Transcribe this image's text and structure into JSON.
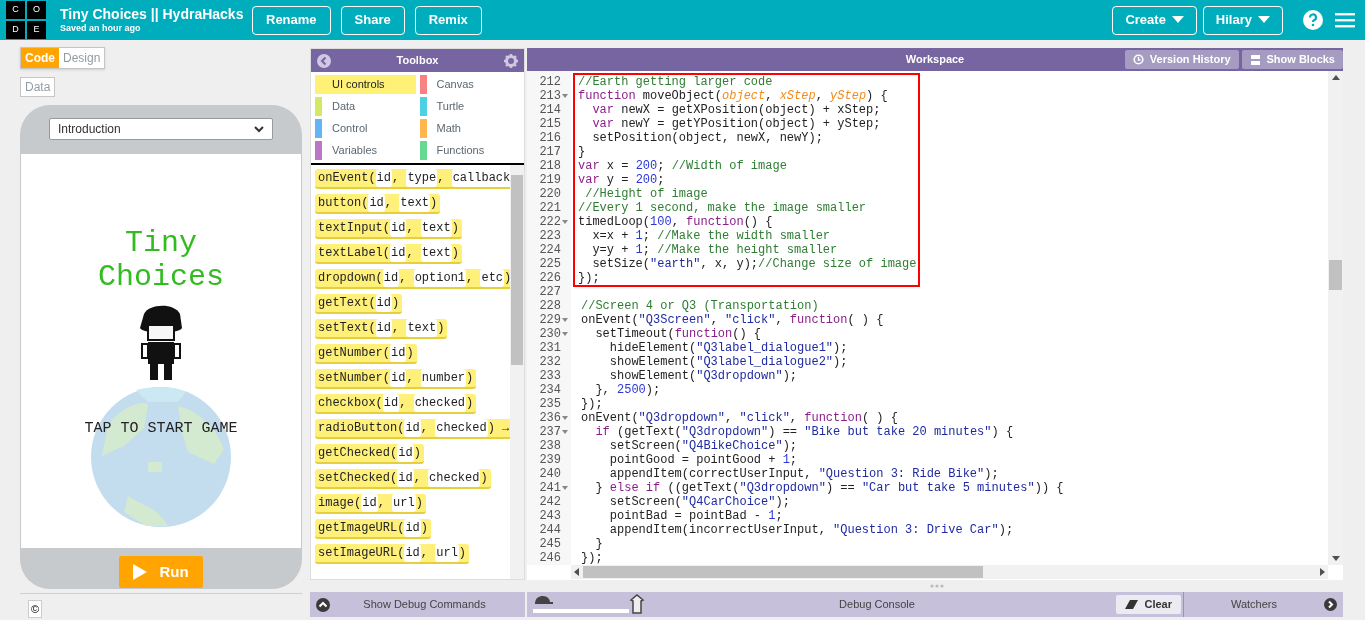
{
  "header": {
    "logo_letters": [
      "C",
      "O",
      "D",
      "E"
    ],
    "title": "Tiny Choices || HydraHacks",
    "subtitle": "Saved an hour ago",
    "buttons": [
      "Rename",
      "Share",
      "Remix"
    ],
    "menus": [
      "Create",
      "Hilary"
    ]
  },
  "mode_tabs": [
    {
      "label": "Code",
      "selected": true
    },
    {
      "label": "Design",
      "selected": false
    }
  ],
  "data_button": "Data",
  "app": {
    "screen_select": "Introduction",
    "title": "Tiny Choices",
    "tap_text": "TAP TO START GAME",
    "run_button": "Run"
  },
  "copyright": "©",
  "toolbox": {
    "title": "Toolbox",
    "categories": [
      {
        "label": "UI controls",
        "color": "#fff176",
        "selected": true
      },
      {
        "label": "Canvas",
        "color": "#f78183",
        "selected": false
      },
      {
        "label": "Data",
        "color": "#d3e965",
        "selected": false
      },
      {
        "label": "Turtle",
        "color": "#4dd0e1",
        "selected": false
      },
      {
        "label": "Control",
        "color": "#64b5f6",
        "selected": false
      },
      {
        "label": "Math",
        "color": "#ffb74d",
        "selected": false
      },
      {
        "label": "Variables",
        "color": "#bb77c7",
        "selected": false
      },
      {
        "label": "Functions",
        "color": "#68d995",
        "selected": false
      }
    ],
    "blocks": [
      [
        {
          "kind": "code",
          "text": "onEvent("
        },
        {
          "kind": "param",
          "text": "id"
        },
        {
          "kind": "code",
          "text": ", "
        },
        {
          "kind": "param",
          "text": "type"
        },
        {
          "kind": "code",
          "text": ", "
        },
        {
          "kind": "param",
          "text": "callback"
        }
      ],
      [
        {
          "kind": "code",
          "text": "button("
        },
        {
          "kind": "param",
          "text": "id"
        },
        {
          "kind": "code",
          "text": ", "
        },
        {
          "kind": "param",
          "text": "text"
        },
        {
          "kind": "code",
          "text": ")"
        }
      ],
      [
        {
          "kind": "code",
          "text": "textInput("
        },
        {
          "kind": "param",
          "text": "id"
        },
        {
          "kind": "code",
          "text": ", "
        },
        {
          "kind": "param",
          "text": "text"
        },
        {
          "kind": "code",
          "text": ")"
        }
      ],
      [
        {
          "kind": "code",
          "text": "textLabel("
        },
        {
          "kind": "param",
          "text": "id"
        },
        {
          "kind": "code",
          "text": ", "
        },
        {
          "kind": "param",
          "text": "text"
        },
        {
          "kind": "code",
          "text": ")"
        }
      ],
      [
        {
          "kind": "code",
          "text": "dropdown("
        },
        {
          "kind": "param",
          "text": "id"
        },
        {
          "kind": "code",
          "text": ", "
        },
        {
          "kind": "param",
          "text": "option1"
        },
        {
          "kind": "code",
          "text": ", "
        },
        {
          "kind": "param",
          "text": "etc"
        },
        {
          "kind": "code",
          "text": ")"
        }
      ],
      [
        {
          "kind": "code",
          "text": "getText("
        },
        {
          "kind": "param",
          "text": "id"
        },
        {
          "kind": "code",
          "text": ")"
        }
      ],
      [
        {
          "kind": "code",
          "text": "setText("
        },
        {
          "kind": "param",
          "text": "id"
        },
        {
          "kind": "code",
          "text": ", "
        },
        {
          "kind": "param",
          "text": "text"
        },
        {
          "kind": "code",
          "text": ")"
        }
      ],
      [
        {
          "kind": "code",
          "text": "getNumber("
        },
        {
          "kind": "param",
          "text": "id"
        },
        {
          "kind": "code",
          "text": ")"
        }
      ],
      [
        {
          "kind": "code",
          "text": "setNumber("
        },
        {
          "kind": "param",
          "text": "id"
        },
        {
          "kind": "code",
          "text": ", "
        },
        {
          "kind": "param",
          "text": "number"
        },
        {
          "kind": "code",
          "text": ")"
        }
      ],
      [
        {
          "kind": "code",
          "text": "checkbox("
        },
        {
          "kind": "param",
          "text": "id"
        },
        {
          "kind": "code",
          "text": ", "
        },
        {
          "kind": "param",
          "text": "checked"
        },
        {
          "kind": "code",
          "text": ")"
        }
      ],
      [
        {
          "kind": "code",
          "text": "radioButton("
        },
        {
          "kind": "param",
          "text": "id"
        },
        {
          "kind": "code",
          "text": ", "
        },
        {
          "kind": "param",
          "text": "checked"
        },
        {
          "kind": "code",
          "text": ") →"
        }
      ],
      [
        {
          "kind": "code",
          "text": "getChecked("
        },
        {
          "kind": "param",
          "text": "id"
        },
        {
          "kind": "code",
          "text": ")"
        }
      ],
      [
        {
          "kind": "code",
          "text": "setChecked("
        },
        {
          "kind": "param",
          "text": "id"
        },
        {
          "kind": "code",
          "text": ", "
        },
        {
          "kind": "param",
          "text": "checked"
        },
        {
          "kind": "code",
          "text": ")"
        }
      ],
      [
        {
          "kind": "code",
          "text": "image("
        },
        {
          "kind": "param",
          "text": "id"
        },
        {
          "kind": "code",
          "text": ", "
        },
        {
          "kind": "param",
          "text": "url"
        },
        {
          "kind": "code",
          "text": ")"
        }
      ],
      [
        {
          "kind": "code",
          "text": "getImageURL("
        },
        {
          "kind": "param",
          "text": "id"
        },
        {
          "kind": "code",
          "text": ")"
        }
      ],
      [
        {
          "kind": "code",
          "text": "setImageURL("
        },
        {
          "kind": "param",
          "text": "id"
        },
        {
          "kind": "code",
          "text": ", "
        },
        {
          "kind": "param",
          "text": "url"
        },
        {
          "kind": "code",
          "text": ")"
        }
      ]
    ]
  },
  "workspace": {
    "title": "Workspace",
    "buttons": [
      "Version History",
      "Show Blocks"
    ],
    "lines": [
      {
        "n": "212",
        "fold": false,
        "boxed": true,
        "tokens": [
          {
            "kind": "comment",
            "text": "//Earth getting larger code"
          }
        ]
      },
      {
        "n": "213",
        "fold": true,
        "boxed": true,
        "tokens": [
          {
            "kind": "keyword",
            "text": "function"
          },
          {
            "kind": "plain",
            "text": " moveObject("
          },
          {
            "kind": "param",
            "text": "object"
          },
          {
            "kind": "plain",
            "text": ", "
          },
          {
            "kind": "param",
            "text": "xStep"
          },
          {
            "kind": "plain",
            "text": ", "
          },
          {
            "kind": "param",
            "text": "yStep"
          },
          {
            "kind": "plain",
            "text": ") {"
          }
        ]
      },
      {
        "n": "214",
        "fold": false,
        "boxed": true,
        "tokens": [
          {
            "kind": "keyword",
            "text": "  var"
          },
          {
            "kind": "plain",
            "text": " newX = getXPosition(object) + xStep;"
          }
        ]
      },
      {
        "n": "215",
        "fold": false,
        "boxed": true,
        "tokens": [
          {
            "kind": "keyword",
            "text": "  var"
          },
          {
            "kind": "plain",
            "text": " newY = getYPosition(object) + yStep;"
          }
        ]
      },
      {
        "n": "216",
        "fold": false,
        "boxed": true,
        "tokens": [
          {
            "kind": "plain",
            "text": "  setPosition(object, newX, newY);"
          }
        ]
      },
      {
        "n": "217",
        "fold": false,
        "boxed": true,
        "tokens": [
          {
            "kind": "plain",
            "text": "}"
          }
        ]
      },
      {
        "n": "218",
        "fold": false,
        "boxed": true,
        "tokens": [
          {
            "kind": "keyword",
            "text": "var"
          },
          {
            "kind": "plain",
            "text": " x = "
          },
          {
            "kind": "number",
            "text": "200"
          },
          {
            "kind": "plain",
            "text": "; "
          },
          {
            "kind": "comment",
            "text": "//Width of image"
          }
        ]
      },
      {
        "n": "219",
        "fold": false,
        "boxed": true,
        "tokens": [
          {
            "kind": "keyword",
            "text": "var"
          },
          {
            "kind": "plain",
            "text": " y = "
          },
          {
            "kind": "number",
            "text": "200"
          },
          {
            "kind": "plain",
            "text": ";"
          }
        ]
      },
      {
        "n": "220",
        "fold": false,
        "boxed": true,
        "tokens": [
          {
            "kind": "comment",
            "text": " //Height of image"
          }
        ]
      },
      {
        "n": "221",
        "fold": false,
        "boxed": true,
        "tokens": [
          {
            "kind": "comment",
            "text": "//Every 1 second, make the image smaller"
          }
        ]
      },
      {
        "n": "222",
        "fold": true,
        "boxed": true,
        "tokens": [
          {
            "kind": "plain",
            "text": "timedLoop("
          },
          {
            "kind": "number",
            "text": "100"
          },
          {
            "kind": "plain",
            "text": ", "
          },
          {
            "kind": "keyword",
            "text": "function"
          },
          {
            "kind": "plain",
            "text": "() {"
          }
        ]
      },
      {
        "n": "223",
        "fold": false,
        "boxed": true,
        "tokens": [
          {
            "kind": "plain",
            "text": "  x=x + "
          },
          {
            "kind": "number",
            "text": "1"
          },
          {
            "kind": "plain",
            "text": "; "
          },
          {
            "kind": "comment",
            "text": "//Make the width smaller"
          }
        ]
      },
      {
        "n": "224",
        "fold": false,
        "boxed": true,
        "tokens": [
          {
            "kind": "plain",
            "text": "  y=y + "
          },
          {
            "kind": "number",
            "text": "1"
          },
          {
            "kind": "plain",
            "text": "; "
          },
          {
            "kind": "comment",
            "text": "//Make the height smaller"
          }
        ]
      },
      {
        "n": "225",
        "fold": false,
        "boxed": true,
        "tokens": [
          {
            "kind": "plain",
            "text": "  setSize("
          },
          {
            "kind": "string",
            "text": "\"earth\""
          },
          {
            "kind": "plain",
            "text": ", x, y);"
          },
          {
            "kind": "comment",
            "text": "//Change size of image"
          }
        ]
      },
      {
        "n": "226",
        "fold": false,
        "boxed": true,
        "tokens": [
          {
            "kind": "plain",
            "text": "});"
          }
        ]
      },
      {
        "n": "227",
        "fold": false,
        "boxed": false
      },
      {
        "n": "228",
        "fold": false,
        "boxed": false,
        "tokens": [
          {
            "kind": "comment",
            "text": "//Screen 4 or Q3 (Transportation)"
          }
        ]
      },
      {
        "n": "229",
        "fold": true,
        "boxed": false,
        "tokens": [
          {
            "kind": "plain",
            "text": "onEvent("
          },
          {
            "kind": "string",
            "text": "\"Q3Screen\""
          },
          {
            "kind": "plain",
            "text": ", "
          },
          {
            "kind": "string",
            "text": "\"click\""
          },
          {
            "kind": "plain",
            "text": ", "
          },
          {
            "kind": "keyword",
            "text": "function"
          },
          {
            "kind": "plain",
            "text": "( ) {"
          }
        ]
      },
      {
        "n": "230",
        "fold": true,
        "boxed": false,
        "tokens": [
          {
            "kind": "plain",
            "text": "  setTimeout("
          },
          {
            "kind": "keyword",
            "text": "function"
          },
          {
            "kind": "plain",
            "text": "() {"
          }
        ]
      },
      {
        "n": "231",
        "fold": false,
        "boxed": false,
        "tokens": [
          {
            "kind": "plain",
            "text": "    hideElement("
          },
          {
            "kind": "string",
            "text": "\"Q3label_dialogue1\""
          },
          {
            "kind": "plain",
            "text": ");"
          }
        ]
      },
      {
        "n": "232",
        "fold": false,
        "boxed": false,
        "tokens": [
          {
            "kind": "plain",
            "text": "    showElement("
          },
          {
            "kind": "string",
            "text": "\"Q3label_dialogue2\""
          },
          {
            "kind": "plain",
            "text": ");"
          }
        ]
      },
      {
        "n": "233",
        "fold": false,
        "boxed": false,
        "tokens": [
          {
            "kind": "plain",
            "text": "    showElement("
          },
          {
            "kind": "string",
            "text": "\"Q3dropdown\""
          },
          {
            "kind": "plain",
            "text": ");"
          }
        ]
      },
      {
        "n": "234",
        "fold": false,
        "boxed": false,
        "tokens": [
          {
            "kind": "plain",
            "text": "  }, "
          },
          {
            "kind": "number",
            "text": "2500"
          },
          {
            "kind": "plain",
            "text": ");"
          }
        ]
      },
      {
        "n": "235",
        "fold": false,
        "boxed": false,
        "tokens": [
          {
            "kind": "plain",
            "text": "});"
          }
        ]
      },
      {
        "n": "236",
        "fold": true,
        "boxed": false,
        "tokens": [
          {
            "kind": "plain",
            "text": "onEvent("
          },
          {
            "kind": "string",
            "text": "\"Q3dropdown\""
          },
          {
            "kind": "plain",
            "text": ", "
          },
          {
            "kind": "string",
            "text": "\"click\""
          },
          {
            "kind": "plain",
            "text": ", "
          },
          {
            "kind": "keyword",
            "text": "function"
          },
          {
            "kind": "plain",
            "text": "( ) {"
          }
        ]
      },
      {
        "n": "237",
        "fold": true,
        "boxed": false,
        "tokens": [
          {
            "kind": "keyword",
            "text": "  if"
          },
          {
            "kind": "plain",
            "text": " (getText("
          },
          {
            "kind": "string",
            "text": "\"Q3dropdown\""
          },
          {
            "kind": "plain",
            "text": ") == "
          },
          {
            "kind": "string",
            "text": "\"Bike but take 20 minutes\""
          },
          {
            "kind": "plain",
            "text": ") {"
          }
        ]
      },
      {
        "n": "238",
        "fold": false,
        "boxed": false,
        "tokens": [
          {
            "kind": "plain",
            "text": "    setScreen("
          },
          {
            "kind": "string",
            "text": "\"Q4BikeChoice\""
          },
          {
            "kind": "plain",
            "text": ");"
          }
        ]
      },
      {
        "n": "239",
        "fold": false,
        "boxed": false,
        "tokens": [
          {
            "kind": "plain",
            "text": "    pointGood = pointGood + "
          },
          {
            "kind": "number",
            "text": "1"
          },
          {
            "kind": "plain",
            "text": ";"
          }
        ]
      },
      {
        "n": "240",
        "fold": false,
        "boxed": false,
        "tokens": [
          {
            "kind": "plain",
            "text": "    appendItem(correctUserInput, "
          },
          {
            "kind": "string",
            "text": "\"Question 3: Ride Bike\""
          },
          {
            "kind": "plain",
            "text": ");"
          }
        ]
      },
      {
        "n": "241",
        "fold": true,
        "boxed": false,
        "tokens": [
          {
            "kind": "plain",
            "text": "  } "
          },
          {
            "kind": "keyword",
            "text": "else if"
          },
          {
            "kind": "plain",
            "text": " ((getText("
          },
          {
            "kind": "string",
            "text": "\"Q3dropdown\""
          },
          {
            "kind": "plain",
            "text": ") == "
          },
          {
            "kind": "string",
            "text": "\"Car but take 5 minutes\""
          },
          {
            "kind": "plain",
            "text": ")) {"
          }
        ]
      },
      {
        "n": "242",
        "fold": false,
        "boxed": false,
        "tokens": [
          {
            "kind": "plain",
            "text": "    setScreen("
          },
          {
            "kind": "string",
            "text": "\"Q4CarChoice\""
          },
          {
            "kind": "plain",
            "text": ");"
          }
        ]
      },
      {
        "n": "243",
        "fold": false,
        "boxed": false,
        "tokens": [
          {
            "kind": "plain",
            "text": "    pointBad = pointBad - "
          },
          {
            "kind": "number",
            "text": "1"
          },
          {
            "kind": "plain",
            "text": ";"
          }
        ]
      },
      {
        "n": "244",
        "fold": false,
        "boxed": false,
        "tokens": [
          {
            "kind": "plain",
            "text": "    appendItem(incorrectUserInput, "
          },
          {
            "kind": "string",
            "text": "\"Question 3: Drive Car\""
          },
          {
            "kind": "plain",
            "text": ");"
          }
        ]
      },
      {
        "n": "245",
        "fold": false,
        "boxed": false,
        "tokens": [
          {
            "kind": "plain",
            "text": "  }"
          }
        ]
      },
      {
        "n": "246",
        "fold": false,
        "boxed": false,
        "tokens": [
          {
            "kind": "plain",
            "text": "});"
          }
        ]
      }
    ]
  },
  "debug": {
    "show_commands": "Show Debug Commands",
    "speed": {
      "level": 1
    },
    "console_title": "Debug Console",
    "clear": "Clear",
    "watchers": "Watchers"
  }
}
